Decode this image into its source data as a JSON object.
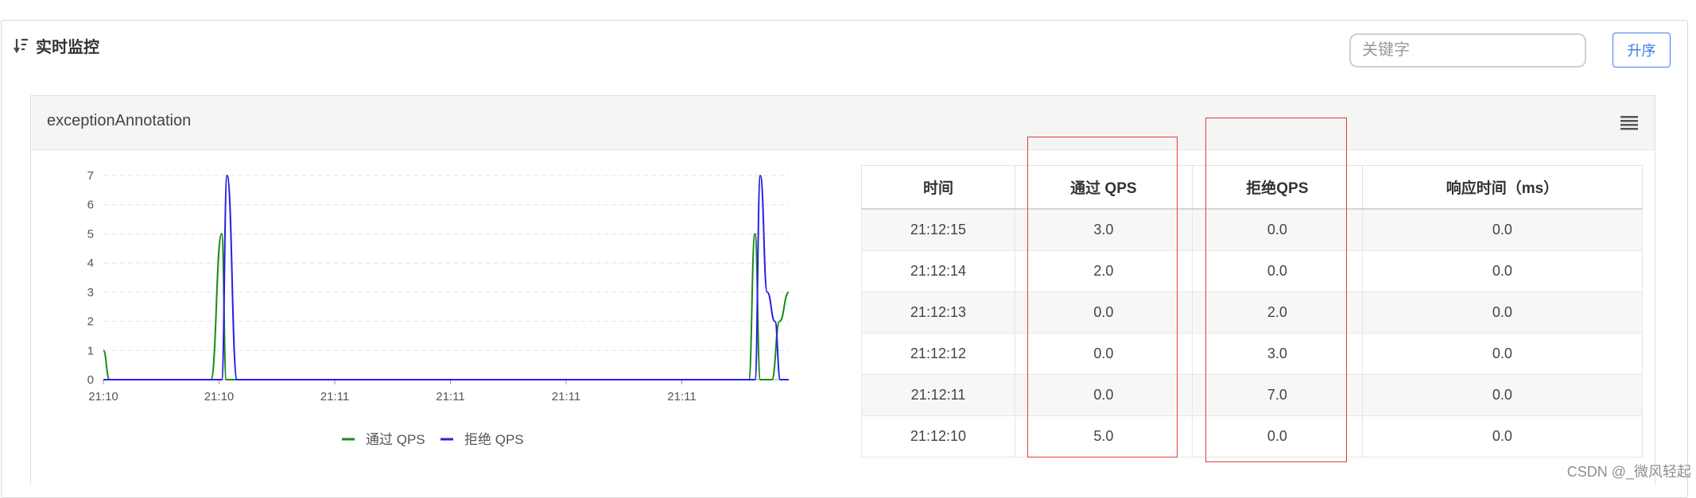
{
  "header": {
    "title": "实时监控",
    "search_placeholder": "关键字",
    "sort_button": "升序"
  },
  "card": {
    "title": "exceptionAnnotation"
  },
  "chart_data": {
    "type": "line",
    "x_tick_labels": [
      "21:10",
      "21:10",
      "21:11",
      "21:11",
      "21:11",
      "21:11"
    ],
    "ylim": [
      0,
      7
    ],
    "y_ticks": [
      0,
      1,
      2,
      3,
      4,
      5,
      6,
      7
    ],
    "grid": true,
    "legend_position": "bottom",
    "series": [
      {
        "name": "通过 QPS",
        "color": "#1a8a1a",
        "points": [
          [
            0,
            1.0
          ],
          [
            0.8,
            0
          ],
          [
            14,
            0
          ],
          [
            15.4,
            5.0
          ],
          [
            16,
            0
          ],
          [
            84,
            0
          ],
          [
            84.8,
            5.0
          ],
          [
            85.5,
            0
          ],
          [
            87,
            0
          ],
          [
            88,
            2.0
          ],
          [
            89.2,
            3.0
          ]
        ]
      },
      {
        "name": "拒绝 QPS",
        "color": "#2a1ee6",
        "points": [
          [
            0,
            0
          ],
          [
            15.4,
            0
          ],
          [
            16.1,
            7.0
          ],
          [
            17.4,
            0
          ],
          [
            84.8,
            0
          ],
          [
            85.5,
            7.0
          ],
          [
            86.4,
            3.0
          ],
          [
            87.4,
            2.0
          ],
          [
            88.1,
            0
          ],
          [
            89.2,
            0
          ]
        ]
      }
    ]
  },
  "table": {
    "headers": [
      "时间",
      "通过 QPS",
      "拒绝QPS",
      "响应时间（ms）"
    ],
    "rows": [
      [
        "21:12:15",
        "3.0",
        "0.0",
        "0.0"
      ],
      [
        "21:12:14",
        "2.0",
        "0.0",
        "0.0"
      ],
      [
        "21:12:13",
        "0.0",
        "2.0",
        "0.0"
      ],
      [
        "21:12:12",
        "0.0",
        "3.0",
        "0.0"
      ],
      [
        "21:12:11",
        "0.0",
        "7.0",
        "0.0"
      ],
      [
        "21:12:10",
        "5.0",
        "0.0",
        "0.0"
      ]
    ]
  },
  "colors": {
    "accent": "#3c7ee4",
    "highlight": "#e53b3b",
    "pass_series": "#1a8a1a",
    "block_series": "#2a1ee6"
  },
  "watermark": "CSDN @_微风轻起"
}
